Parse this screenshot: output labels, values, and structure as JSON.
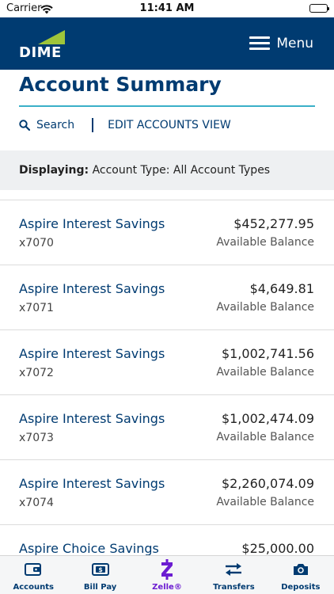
{
  "status_bar": {
    "carrier": "Carrier",
    "time": "11:41 AM"
  },
  "header": {
    "logo_text": "DIME",
    "menu_label": "Menu",
    "colors": {
      "background": "#003b71",
      "logo_accent": "#9fc53a"
    }
  },
  "page": {
    "title": "Account Summary",
    "search_label": "Search",
    "edit_label": "EDIT ACCOUNTS VIEW"
  },
  "filter": {
    "label": "Displaying:",
    "value": "Account Type: All Account Types"
  },
  "accounts": [
    {
      "name": "Aspire Interest Savings",
      "number": "x7070",
      "amount": "$452,277.95",
      "balance_label": "Available Balance"
    },
    {
      "name": "Aspire Interest Savings",
      "number": "x7071",
      "amount": "$4,649.81",
      "balance_label": "Available Balance"
    },
    {
      "name": "Aspire Interest Savings",
      "number": "x7072",
      "amount": "$1,002,741.56",
      "balance_label": "Available Balance"
    },
    {
      "name": "Aspire Interest Savings",
      "number": "x7073",
      "amount": "$1,002,474.09",
      "balance_label": "Available Balance"
    },
    {
      "name": "Aspire Interest Savings",
      "number": "x7074",
      "amount": "$2,260,074.09",
      "balance_label": "Available Balance"
    },
    {
      "name": "Aspire Choice Savings",
      "number": "",
      "amount": "$25,000.00",
      "balance_label": ""
    }
  ],
  "tabs": [
    {
      "label": "Accounts",
      "icon": "wallet-icon"
    },
    {
      "label": "Bill Pay",
      "icon": "dollar-bill-icon"
    },
    {
      "label": "Zelle®",
      "icon": "zelle-icon"
    },
    {
      "label": "Transfers",
      "icon": "transfer-arrows-icon"
    },
    {
      "label": "Deposits",
      "icon": "camera-icon"
    }
  ]
}
